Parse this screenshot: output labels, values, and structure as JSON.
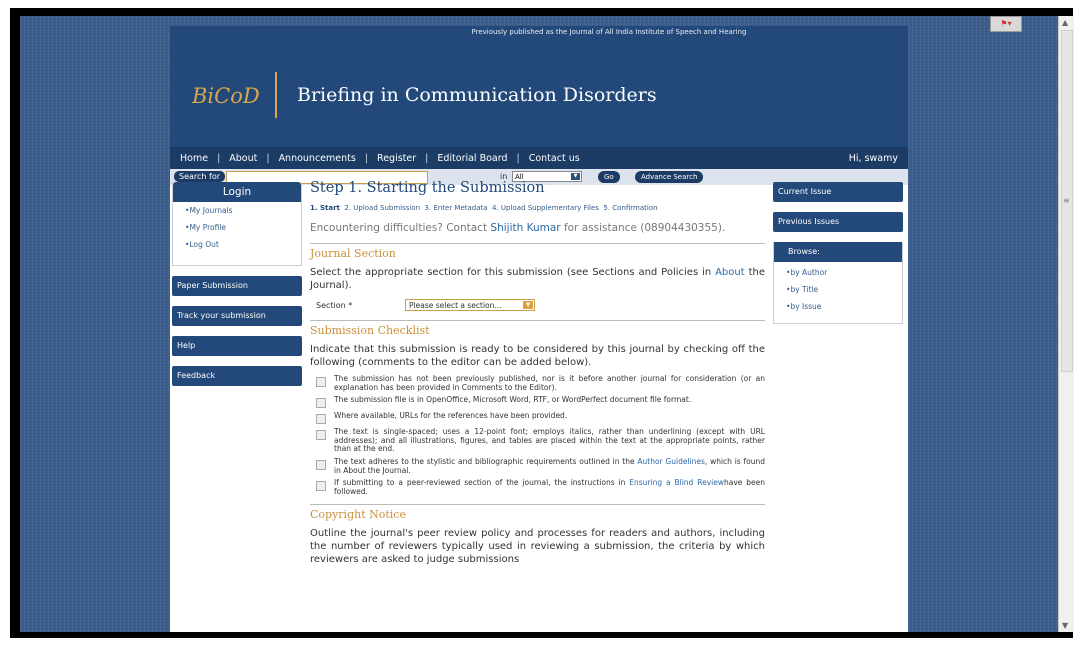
{
  "header": {
    "banner": "Previously published as the Journal of All India Institute of Speech and Hearing",
    "logo": "BiCoD",
    "site_title": "Briefing in Communication Disorders"
  },
  "nav": {
    "items": [
      "Home",
      "About",
      "Announcements",
      "Register",
      "Editorial Board",
      "Contact us"
    ],
    "greeting": "Hi, swamy"
  },
  "search": {
    "label": "Search for",
    "input_value": "",
    "in_label": "in",
    "scope": "All",
    "go": "Go",
    "advanced": "Advance Search"
  },
  "login": {
    "title": "Login",
    "items": [
      "My Journals",
      "My Profile",
      "Log Out"
    ]
  },
  "sidebar_left": [
    "Paper Submission",
    "Track your submission",
    "Help",
    "Feedback"
  ],
  "sidebar_right": {
    "buttons": [
      "Current Issue",
      "Previous Issues"
    ],
    "browse_title": "Browse:",
    "browse_items": [
      "by Author",
      "by Title",
      "by Issue"
    ]
  },
  "main": {
    "title": "Step 1. Starting the Submission",
    "steps": [
      "1. Start",
      "2. Upload Submission",
      "3. Enter Metadata",
      "4. Upload Supplementary Files",
      "5. Confirmation"
    ],
    "difficulty_pre": "Encountering difficulties? Contact",
    "contact_name": "Shijith Kumar",
    "difficulty_post": "for assistance (08904430355).",
    "journal_section": {
      "heading": "Journal Section",
      "text_pre": "Select the appropriate section for this submission (see Sections and Policies in",
      "text_link": "About",
      "text_post": "the Journal).",
      "field_label": "Section *",
      "select_value": "Please select a section..."
    },
    "checklist": {
      "heading": "Submission Checklist",
      "intro": "Indicate that this submission is ready to be considered by this journal by checking off the following (comments to the editor can be added below).",
      "items": [
        "The submission has not been previously published, nor is it before another journal for consideration (or an explanation has been provided in Comments to the Editor).",
        "The submission file is in OpenOffice, Microsoft Word, RTF, or WordPerfect document file format.",
        "Where available, URLs for the references have been provided.",
        "The text is single-spaced; uses a 12-point font; employs italics, rather than underlining (except with URL addresses); and all illustrations, figures, and tables are placed within the text at the appropriate points, rather than at the end."
      ],
      "item5_pre": "The text adheres to the stylistic and bibliographic requirements outlined in the",
      "item5_link": "Author Guidelines",
      "item5_post": ", which is found in About the Journal.",
      "item6_pre": "If submitting to a peer-reviewed section of the journal, the instructions in",
      "item6_link": "Ensuring a Blind Review",
      "item6_post": "have been followed."
    },
    "copyright": {
      "heading": "Copyright Notice",
      "text": "Outline the journal's peer review policy and processes for readers and authors, including the number of reviewers typically used in reviewing a submission, the criteria by which reviewers are asked to judge submissions"
    }
  }
}
